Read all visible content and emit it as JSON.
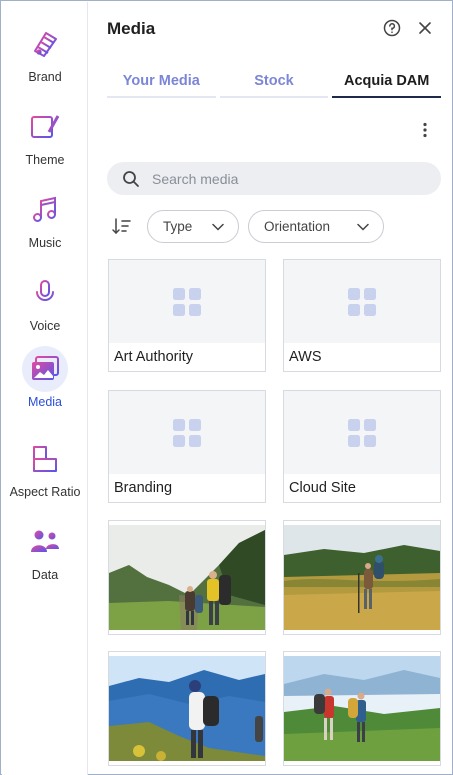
{
  "sidebar": {
    "items": [
      {
        "label": "Brand",
        "icon": "brand-icon"
      },
      {
        "label": "Theme",
        "icon": "theme-icon"
      },
      {
        "label": "Music",
        "icon": "music-icon"
      },
      {
        "label": "Voice",
        "icon": "microphone-icon"
      },
      {
        "label": "Media",
        "icon": "media-icon",
        "active": true
      },
      {
        "label": "Aspect Ratio",
        "icon": "aspect-ratio-icon"
      },
      {
        "label": "Data",
        "icon": "data-icon"
      }
    ]
  },
  "header": {
    "title": "Media"
  },
  "tabs": [
    {
      "label": "Your Media"
    },
    {
      "label": "Stock"
    },
    {
      "label": "Acquia DAM",
      "active": true
    }
  ],
  "search": {
    "placeholder": "Search media",
    "value": ""
  },
  "filters": {
    "type_label": "Type",
    "orientation_label": "Orientation"
  },
  "folders": [
    {
      "label": "Art Authority"
    },
    {
      "label": "AWS"
    },
    {
      "label": "Branding"
    },
    {
      "label": "Cloud Site"
    }
  ],
  "images": [
    {
      "name": "hikers-mountain-trail"
    },
    {
      "name": "hikers-golden-meadow"
    },
    {
      "name": "hiker-blue-mountains"
    },
    {
      "name": "hikers-misty-valley"
    }
  ],
  "colors": {
    "accent": "#2b4fd6",
    "icon_gradient_start": "#e04aa0",
    "icon_gradient_end": "#5a55e8",
    "tab_inactive": "#7b86d8",
    "search_bg": "#eceef2"
  }
}
